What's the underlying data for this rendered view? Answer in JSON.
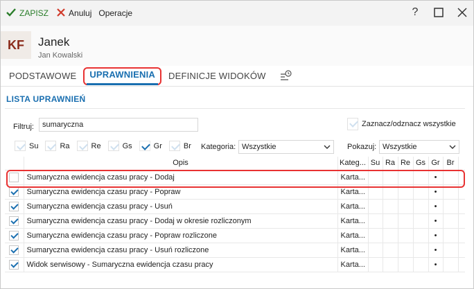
{
  "toolbar": {
    "save_label": "ZAPISZ",
    "cancel_label": "Anuluj",
    "operations_label": "Operacje"
  },
  "window": {
    "help_icon": "?",
    "maximize_icon": "☐",
    "close_icon": "✕"
  },
  "header": {
    "initials": "KF",
    "name": "Janek",
    "subtitle": "Jan Kowalski"
  },
  "tabs": [
    {
      "label": "PODSTAWOWE",
      "active": false
    },
    {
      "label": "UPRAWNIENIA",
      "active": true
    },
    {
      "label": "DEFINICJE WIDOKÓW",
      "active": false
    }
  ],
  "section": {
    "title": "LISTA UPRAWNIEŃ"
  },
  "filter": {
    "label": "Filtruj:",
    "value": "sumaryczna"
  },
  "select_all_label": "Zaznacz/odznacz wszystkie",
  "type_filters": [
    {
      "label": "Su",
      "checked": false
    },
    {
      "label": "Ra",
      "checked": false
    },
    {
      "label": "Re",
      "checked": false
    },
    {
      "label": "Gs",
      "checked": false
    },
    {
      "label": "Gr",
      "checked": true
    },
    {
      "label": "Br",
      "checked": false
    }
  ],
  "category": {
    "label": "Kategoria:",
    "value": "Wszystkie"
  },
  "show": {
    "label": "Pokazuj:",
    "value": "Wszystkie"
  },
  "grid": {
    "columns": [
      "Opis",
      "Kateg...",
      "Su",
      "Ra",
      "Re",
      "Gs",
      "Gr",
      "Br"
    ],
    "rows": [
      {
        "checked": false,
        "description": "Sumaryczna ewidencja czasu pracy - Dodaj",
        "category": "Karta...",
        "gr": "•"
      },
      {
        "checked": true,
        "description": "Sumaryczna ewidencja czasu pracy - Popraw",
        "category": "Karta...",
        "gr": "•"
      },
      {
        "checked": true,
        "description": "Sumaryczna ewidencja czasu pracy - Usuń",
        "category": "Karta...",
        "gr": "•"
      },
      {
        "checked": true,
        "description": "Sumaryczna ewidencja czasu pracy - Dodaj w okresie rozliczonym",
        "category": "Karta...",
        "gr": "•"
      },
      {
        "checked": true,
        "description": "Sumaryczna ewidencja czasu pracy - Popraw rozliczone",
        "category": "Karta...",
        "gr": "•"
      },
      {
        "checked": true,
        "description": "Sumaryczna ewidencja czasu pracy - Usuń rozliczone",
        "category": "Karta...",
        "gr": "•"
      },
      {
        "checked": true,
        "description": "Widok serwisowy - Sumaryczna ewidencja czasu pracy",
        "category": "Karta...",
        "gr": "•"
      }
    ]
  },
  "colors": {
    "accent": "#1a6fb0",
    "save_green": "#2a7d2a",
    "highlight_red": "#e83232",
    "avatar_text": "#8a2a1a"
  },
  "icons": {
    "save": "check-icon",
    "cancel": "x-icon",
    "history": "history-icon"
  }
}
